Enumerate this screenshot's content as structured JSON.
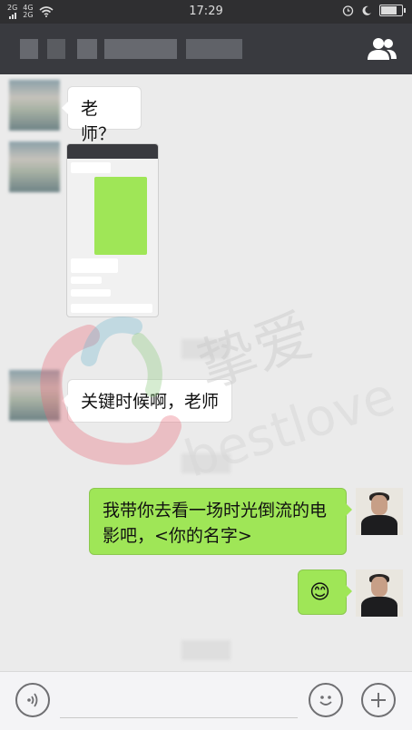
{
  "status_bar": {
    "signal1": "2G",
    "signal2_top": "4G",
    "signal2_bottom": "2G",
    "time": "17:29",
    "battery_level": 0.75
  },
  "chat": {
    "messages": [
      {
        "side": "left",
        "text": "老师？"
      },
      {
        "side": "left",
        "type": "image"
      },
      {
        "side": "left",
        "text": "关键时候啊，老师"
      },
      {
        "side": "right",
        "text": "我带你去看一场时光倒流的电影吧，<你的名字>"
      },
      {
        "side": "right",
        "text": "😊"
      }
    ]
  },
  "icons": {
    "contacts": "people-icon",
    "voice": "voice-icon",
    "emoji": "emoji-icon",
    "add": "plus-icon"
  },
  "watermark": {
    "logo_text": "挚爱",
    "logo_latin": "bestlove"
  }
}
